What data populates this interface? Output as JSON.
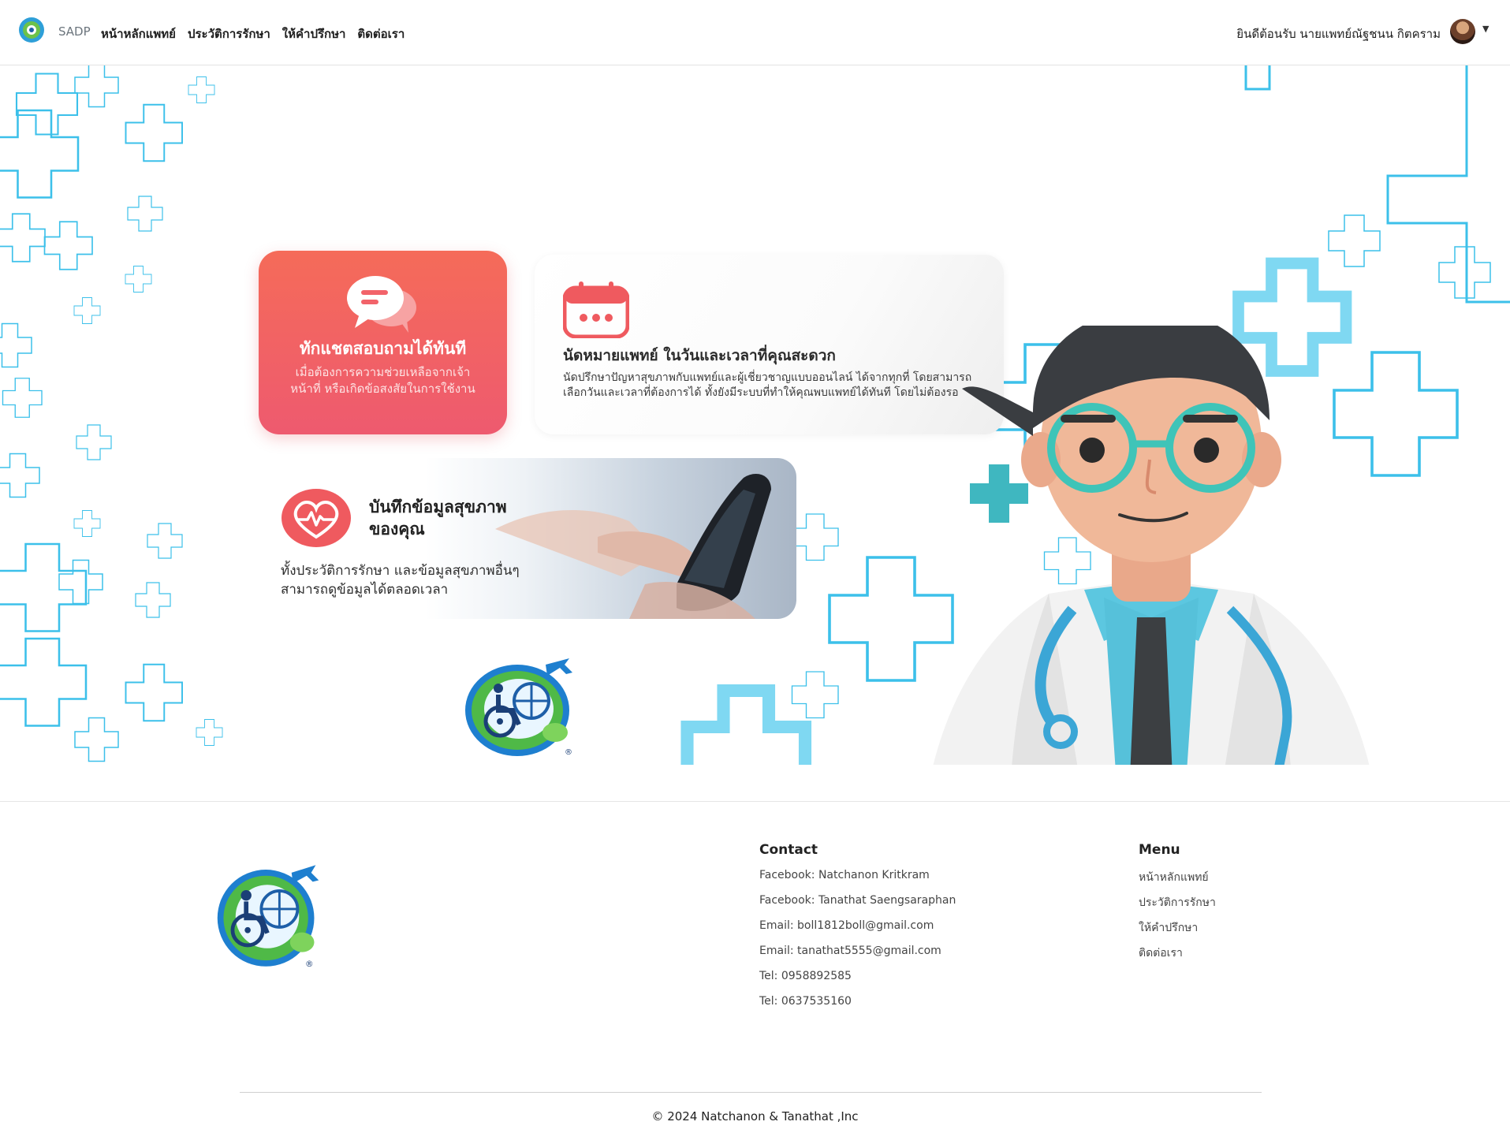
{
  "navbar": {
    "brand": "SADP",
    "links": [
      "หน้าหลักแพทย์",
      "ประวัติการรักษา",
      "ให้คำปรึกษา",
      "ติดต่อเรา"
    ],
    "welcome": "ยินดีต้อนรับ  นายแพทย์ณัฐชนน กิตคราม"
  },
  "hero": {
    "chat_card": {
      "title": "ทักแชตสอบถามได้ทันที",
      "description": "เมื่อต้องการความช่วยเหลือจากเจ้าหน้าที่ หรือเกิดข้อสงสัยในการใช้งาน"
    },
    "appointment_card": {
      "title": "นัดหมายแพทย์ ในวันและเวลาที่คุณสะดวก",
      "description": "นัดปรึกษาปัญหาสุขภาพกับแพทย์และผู้เชี่ยวชาญแบบออนไลน์ ได้จากทุกที่ โดยสามารถเลือกวันและเวลาที่ต้องการได้ ทั้งยังมีระบบที่ทำให้คุณพบแพทย์ได้ทันที โดยไม่ต้องรอ"
    },
    "record_card": {
      "title": "บันทึกข้อมูลสุขภาพของคุณ",
      "description": "ทั้งประวัติการรักษา และข้อมูลสุขภาพอื่นๆ สามารถดูข้อมูลได้ตลอดเวลา"
    }
  },
  "footer": {
    "contact": {
      "title": "Contact",
      "items": [
        "Facebook: Natchanon Kritkram",
        "Facebook: Tanathat Saengsaraphan",
        "Email: boll1812boll@gmail.com",
        "Email: tanathat5555@gmail.com",
        "Tel: 0958892585",
        "Tel: 0637535160"
      ]
    },
    "menu": {
      "title": "Menu",
      "items": [
        "หน้าหลักแพทย์",
        "ประวัติการรักษา",
        "ให้คำปรึกษา",
        "ติดต่อเรา"
      ]
    },
    "copyright": "© 2024 Natchanon & Tanathat ,Inc"
  },
  "colors": {
    "accent_cyan": "#3fc3ea",
    "chat_card": "#f2636a",
    "teal": "#3fb7c0"
  }
}
